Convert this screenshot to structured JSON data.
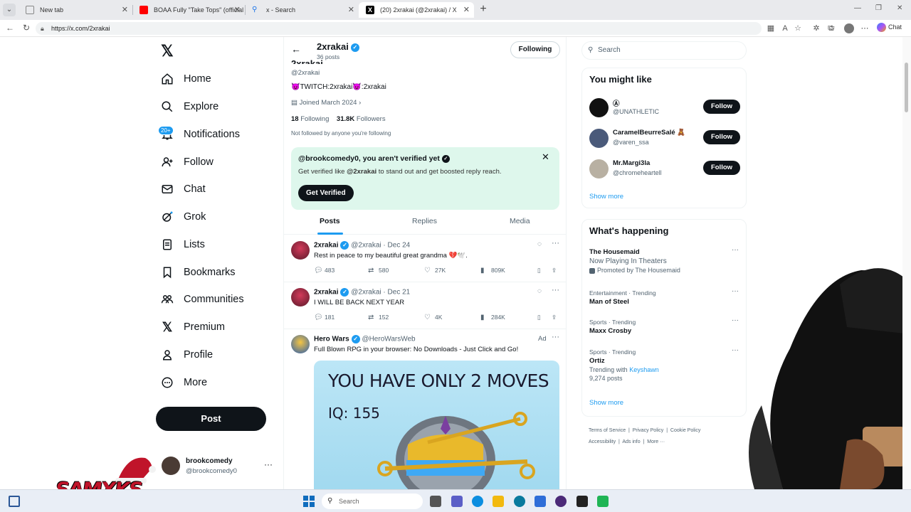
{
  "browser": {
    "tabs": [
      {
        "title": "New tab"
      },
      {
        "title": "BOAA Fully \"Take Tops\" (official vi"
      },
      {
        "title": "x - Search"
      },
      {
        "title": "(20) 2xrakai (@2xrakai) / X"
      }
    ],
    "url": "https://x.com/2xrakai",
    "chat_label": "Chat"
  },
  "nav": {
    "items": [
      {
        "label": "Home",
        "icon": "home-icon"
      },
      {
        "label": "Explore",
        "icon": "search-icon"
      },
      {
        "label": "Notifications",
        "icon": "bell-icon"
      },
      {
        "label": "Follow",
        "icon": "add-person-icon"
      },
      {
        "label": "Chat",
        "icon": "mail-icon"
      },
      {
        "label": "Grok",
        "icon": "grok-icon"
      },
      {
        "label": "Lists",
        "icon": "list-icon"
      },
      {
        "label": "Bookmarks",
        "icon": "bookmark-icon"
      },
      {
        "label": "Communities",
        "icon": "people-icon"
      },
      {
        "label": "Premium",
        "icon": "x-logo-icon"
      },
      {
        "label": "Profile",
        "icon": "person-icon"
      },
      {
        "label": "More",
        "icon": "more-circle-icon"
      }
    ],
    "notification_badge": "20+",
    "post_label": "Post",
    "account": {
      "name": "brookcomedy",
      "handle": "@brookcomedy0"
    }
  },
  "overlay_text": "SAMXKS",
  "profile": {
    "header_name": "2xrakai",
    "header_posts": "36 posts",
    "following_button": "Following",
    "handle": "@2xrakai",
    "bio": "😈TWITCH:2xrakai😈:2xrakai",
    "joined": "Joined March 2024",
    "following_count": "18",
    "following_label": "Following",
    "followers_count": "31.8K",
    "followers_label": "Followers",
    "not_followed": "Not followed by anyone you're following"
  },
  "verify_banner": {
    "title": "@brookcomedy0, you aren't verified yet",
    "subtitle_pre": "Get verified like ",
    "subtitle_handle": "@2xrakai",
    "subtitle_post": " to stand out and get boosted reply reach.",
    "button": "Get Verified"
  },
  "profile_tabs": [
    "Posts",
    "Replies",
    "Media"
  ],
  "tweets": [
    {
      "name": "2xrakai",
      "handle": "@2xrakai",
      "date": "Dec 24",
      "text": "Rest in peace to my beautiful great grandma 💔🕊️.",
      "replies": "483",
      "reposts": "580",
      "likes": "27K",
      "views": "809K"
    },
    {
      "name": "2xrakai",
      "handle": "@2xrakai",
      "date": "Dec 21",
      "text": "I WILL BE BACK NEXT YEAR",
      "replies": "181",
      "reposts": "152",
      "likes": "4K",
      "views": "284K"
    }
  ],
  "ad": {
    "name": "Hero Wars",
    "handle": "@HeroWarsWeb",
    "label": "Ad",
    "text": "Full Blown RPG in your browser: No Downloads - Just Click and Go!",
    "headline": "YOU HAVE ONLY 2 MOVES",
    "sub": "IQ: 155"
  },
  "right": {
    "search_placeholder": "Search",
    "might_like_title": "You might like",
    "suggestions": [
      {
        "name": "Ⓐ",
        "handle": "@UNATHLETIC",
        "button": "Follow"
      },
      {
        "name": "CaramelBeurreSalé 🧸",
        "handle": "@varen_ssa",
        "button": "Follow"
      },
      {
        "name": "Mr.Margi3la",
        "handle": "@chromeheartell",
        "button": "Follow"
      }
    ],
    "show_more": "Show more",
    "happening_title": "What's happening",
    "trends": [
      {
        "context": "The Housemaid",
        "title": "Now Playing In Theaters",
        "extra": "Promoted by The Housemaid"
      },
      {
        "context": "Entertainment · Trending",
        "title": "Man of Steel",
        "extra": ""
      },
      {
        "context": "Sports · Trending",
        "title": "Maxx Crosby",
        "extra": ""
      },
      {
        "context": "Sports · Trending",
        "title": "Ortiz",
        "extra_pre": "Trending with ",
        "extra_link": "Keyshawn",
        "posts": "9,274 posts"
      }
    ],
    "footer": [
      "Terms of Service",
      "Privacy Policy",
      "Cookie Policy",
      "Accessibility",
      "Ads info",
      "More ···"
    ]
  },
  "taskbar": {
    "search_placeholder": "Search"
  },
  "colors": {
    "accent": "#1d9bf0",
    "verify_bg": "#def7ec",
    "text": "#0f1419",
    "muted": "#536471"
  }
}
